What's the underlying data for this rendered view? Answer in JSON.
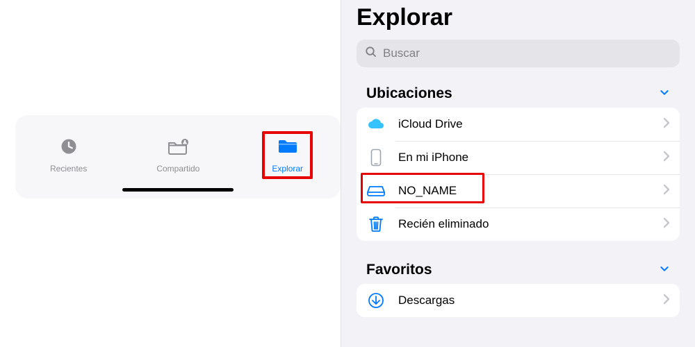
{
  "tabs": {
    "recents": "Recientes",
    "shared": "Compartido",
    "browse": "Explorar"
  },
  "page": {
    "title": "Explorar",
    "search_placeholder": "Buscar"
  },
  "sections": {
    "locations": {
      "title": "Ubicaciones",
      "items": {
        "icloud": "iCloud Drive",
        "iphone": "En mi iPhone",
        "noname": "NO_NAME",
        "trash": "Recién eliminado"
      }
    },
    "favorites": {
      "title": "Favoritos",
      "items": {
        "downloads": "Descargas"
      }
    }
  },
  "colors": {
    "accent": "#007aff",
    "highlight": "#e60000",
    "icon_cloud": "#34c3ff",
    "icon_iphone": "#9da6b0",
    "icon_drive": "#007aff",
    "icon_trash": "#007aff",
    "icon_download": "#007aff"
  }
}
